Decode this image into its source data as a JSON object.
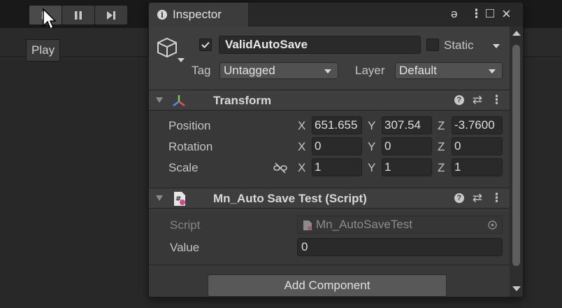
{
  "editor": {
    "tooltip": "Play"
  },
  "inspector": {
    "tab_label": "Inspector",
    "window_controls": {
      "lock": "ə",
      "menu": "⋮",
      "maximize": "□",
      "close": "×"
    },
    "gameobject": {
      "active": true,
      "name": "ValidAutoSave",
      "static_label": "Static",
      "static_checked": false,
      "tag_label": "Tag",
      "tag_value": "Untagged",
      "layer_label": "Layer",
      "layer_value": "Default"
    },
    "transform": {
      "title": "Transform",
      "rows": [
        {
          "label": "Position",
          "x": "651.655",
          "y": "307.54",
          "z": "-3.7600"
        },
        {
          "label": "Rotation",
          "x": "0",
          "y": "0",
          "z": "0"
        },
        {
          "label": "Scale",
          "x": "1",
          "y": "1",
          "z": "1"
        }
      ],
      "axis": {
        "x": "X",
        "y": "Y",
        "z": "Z"
      }
    },
    "script_component": {
      "title": "Mn_Auto Save Test (Script)",
      "script_label": "Script",
      "script_value": "Mn_AutoSaveTest",
      "value_label": "Value",
      "value": "0"
    },
    "add_component_label": "Add Component"
  },
  "colors": {
    "background": "#282828",
    "panel": "#383838",
    "header": "#3e3e3e",
    "field": "#2a2a2a"
  }
}
